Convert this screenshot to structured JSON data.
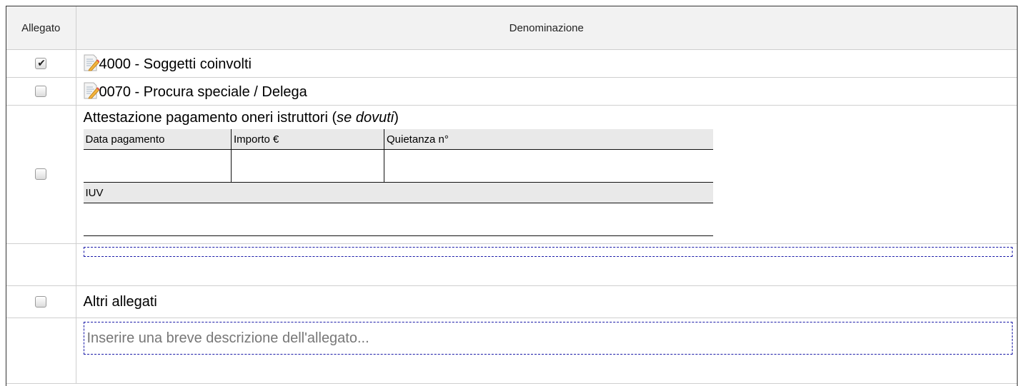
{
  "header": {
    "col_allegato": "Allegato",
    "col_denominazione": "Denominazione"
  },
  "rows": [
    {
      "checked": true,
      "icon": "edit-document-icon",
      "label": "4000 - Soggetti coinvolti"
    },
    {
      "checked": false,
      "icon": "edit-document-icon",
      "label": "0070 - Procura speciale / Delega"
    }
  ],
  "payment": {
    "title": "Attestazione pagamento oneri istruttori",
    "paren_open": " (",
    "note": "se dovuti",
    "paren_close": ")",
    "checked": false,
    "data_label": "Data pagamento",
    "importo_label": "Importo €",
    "quietanza_label": "Quietanza n°",
    "iuv_label": "IUV",
    "data_value": "",
    "importo_value": "",
    "quietanza_value": "",
    "iuv_value": ""
  },
  "payment_note_value": "",
  "altri": {
    "label": "Altri allegati",
    "checked": false,
    "placeholder": "Inserire una breve descrizione dell'allegato..."
  }
}
